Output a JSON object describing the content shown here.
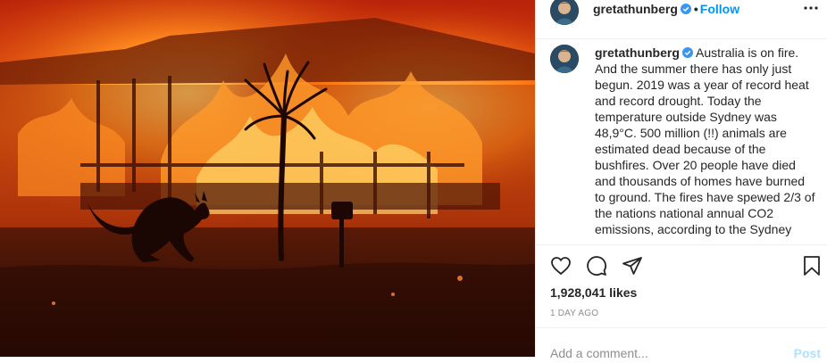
{
  "post": {
    "image_alt": "House on fire with kangaroo in foreground",
    "username": "gretathunberg",
    "separator": "•",
    "follow_label": "Follow",
    "caption_text": "Australia is on fire. And the summer there has only just begun. 2019 was a year of record heat and record drought. Today the temperature outside Sydney was 48,9°C. 500 million (!!) animals are estimated dead because of the bushfires. Over 20 people have died and thousands of homes have burned to ground. The fires have spewed 2/3 of the nations national annual CO2 emissions, according to the Sydney",
    "likes": "1,928,041 likes",
    "timestamp": "1 DAY AGO"
  },
  "comment": {
    "placeholder": "Add a comment...",
    "post_label": "Post"
  },
  "colors": {
    "follow": "#0095f6",
    "verified": "#3897f0",
    "post_disabled": "#b2dffc",
    "muted": "#8e8e8e"
  },
  "icons": [
    "verified-badge-icon",
    "more-options-icon",
    "heart-icon",
    "comment-icon",
    "share-icon",
    "bookmark-icon"
  ]
}
